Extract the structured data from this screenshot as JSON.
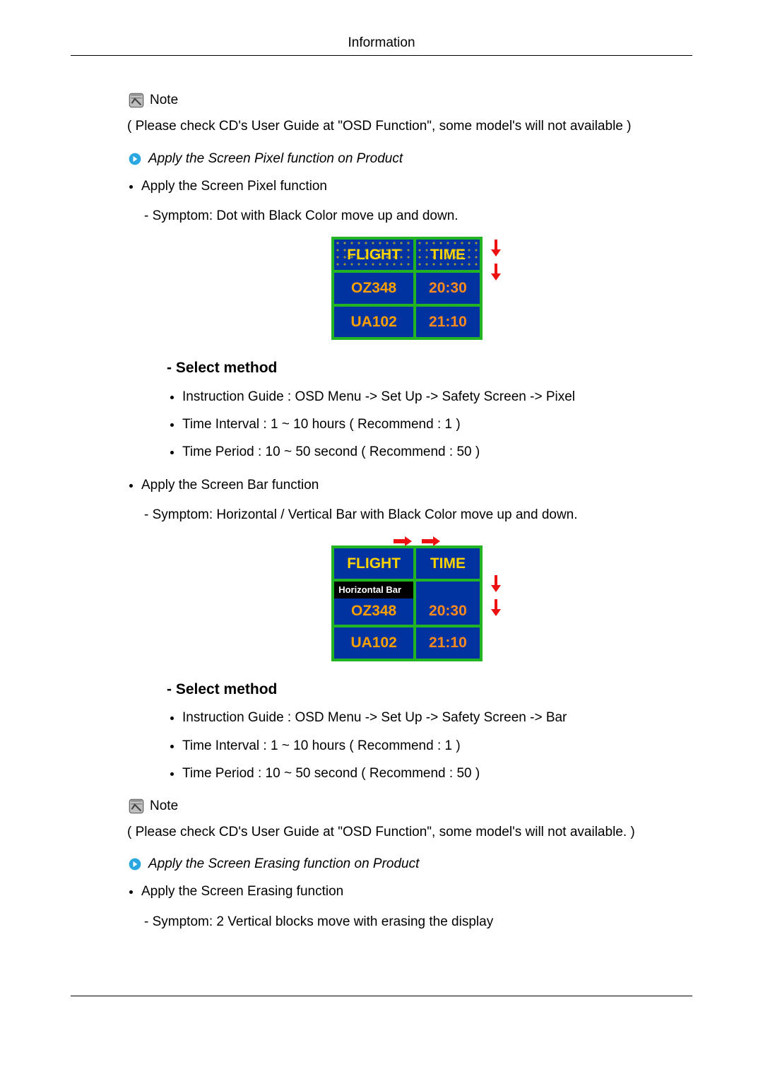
{
  "header": {
    "title": "Information"
  },
  "note1": {
    "label": "Note",
    "text": "( Please check CD's User Guide at \"OSD Function\", some model's will not available )"
  },
  "section_pixel": {
    "arrow_text": "Apply the Screen Pixel function on Product",
    "bullet": "Apply the Screen Pixel function",
    "symptom": "- Symptom: Dot with Black Color move up and down.",
    "table": {
      "h1": "FLIGHT",
      "h2": "TIME",
      "r1c1": "OZ348",
      "r1c2": "20:30",
      "r2c1": "UA102",
      "r2c2": "21:10"
    },
    "select_hdr": "- Select method",
    "items": [
      "Instruction Guide : OSD Menu -> Set Up -> Safety Screen -> Pixel",
      "Time Interval : 1 ~ 10 hours ( Recommend : 1 )",
      "Time Period : 10 ~ 50 second ( Recommend : 50 )"
    ]
  },
  "section_bar": {
    "bullet": "Apply the Screen Bar function",
    "symptom": "- Symptom: Horizontal / Vertical Bar with Black Color move up and down.",
    "table": {
      "h1": "FLIGHT",
      "h2": "TIME",
      "hbar": "Horizontal Bar",
      "r1c1": "OZ348",
      "r1c2": "20:30",
      "r2c1": "UA102",
      "r2c2": "21:10"
    },
    "select_hdr": "- Select method",
    "items": [
      "Instruction Guide : OSD Menu -> Set Up -> Safety Screen -> Bar",
      "Time Interval : 1 ~ 10 hours ( Recommend : 1 )",
      "Time Period : 10 ~ 50 second ( Recommend : 50 )"
    ]
  },
  "note2": {
    "label": "Note",
    "text": "( Please check CD's User Guide at \"OSD Function\", some model's will not available. )"
  },
  "section_erase": {
    "arrow_text": "Apply the Screen Erasing function on Product",
    "bullet": "Apply the Screen Erasing function",
    "symptom": "- Symptom: 2 Vertical blocks move with erasing the display"
  }
}
